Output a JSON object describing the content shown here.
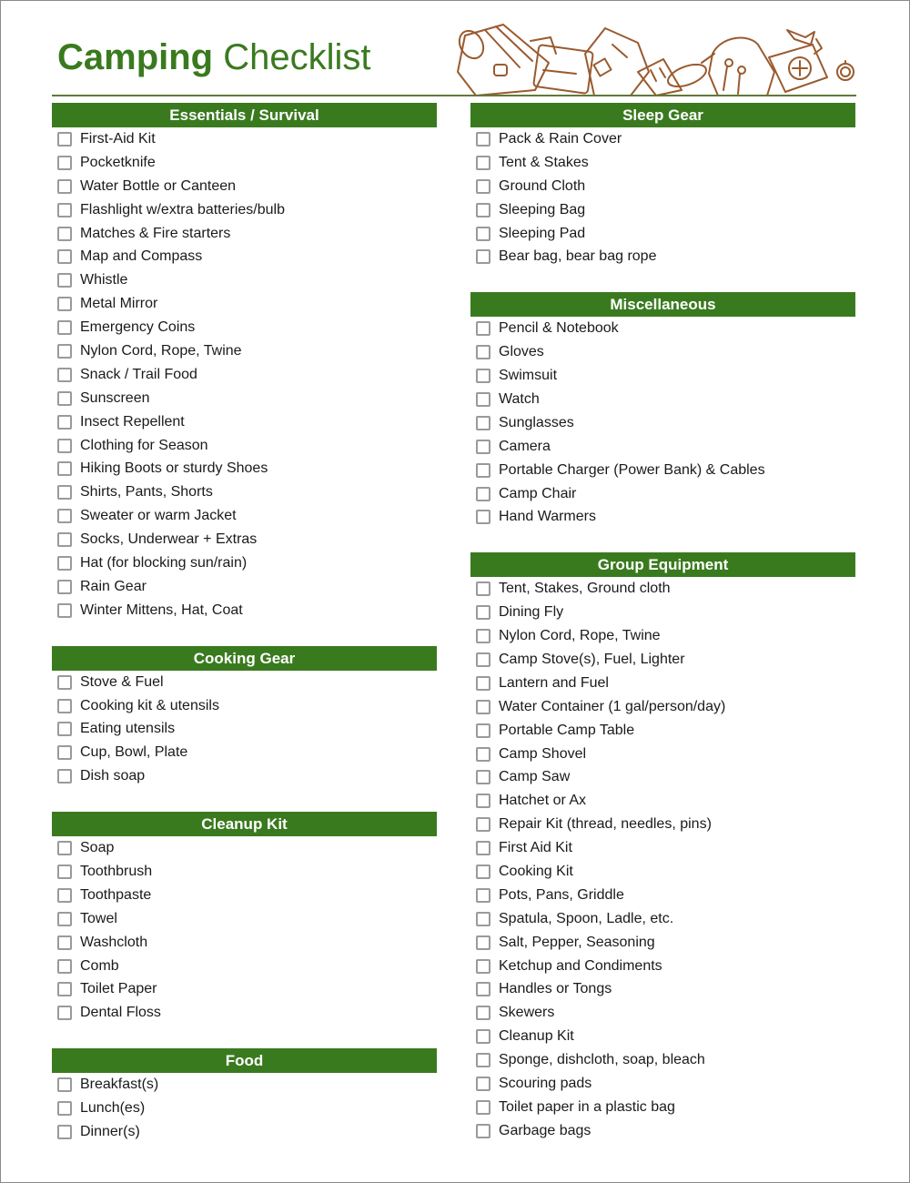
{
  "title": {
    "bold": "Camping",
    "regular": "Checklist"
  },
  "colors": {
    "accent": "#3a7a1f",
    "illustration": "#9a5a2e",
    "checkbox_border": "#9a9a9a"
  },
  "illustration": {
    "icons": [
      "sleeping-bag-icon",
      "suitcase-icon",
      "map-icon",
      "sunscreen-icon",
      "fish-icon",
      "backpack-icon",
      "first-aid-kit-icon",
      "pocketknife-icon",
      "compass-icon"
    ]
  },
  "left_column": [
    {
      "header": "Essentials / Survival",
      "items": [
        "First-Aid Kit",
        "Pocketknife",
        "Water Bottle or Canteen",
        "Flashlight w/extra batteries/bulb",
        "Matches & Fire starters",
        "Map and Compass",
        "Whistle",
        "Metal Mirror",
        "Emergency Coins",
        "Nylon Cord, Rope, Twine",
        "Snack / Trail Food",
        "Sunscreen",
        "Insect Repellent",
        "Clothing for Season",
        "Hiking Boots or sturdy Shoes",
        "Shirts, Pants, Shorts",
        "Sweater or warm Jacket",
        "Socks, Underwear + Extras",
        "Hat (for blocking sun/rain)",
        "Rain Gear",
        "Winter Mittens, Hat, Coat"
      ]
    },
    {
      "header": "Cooking Gear",
      "items": [
        "Stove & Fuel",
        "Cooking kit & utensils",
        "Eating utensils",
        "Cup, Bowl, Plate",
        "Dish soap"
      ]
    },
    {
      "header": "Cleanup Kit",
      "items": [
        "Soap",
        "Toothbrush",
        "Toothpaste",
        "Towel",
        "Washcloth",
        "Comb",
        "Toilet Paper",
        "Dental Floss"
      ]
    },
    {
      "header": "Food",
      "items": [
        "Breakfast(s)",
        "Lunch(es)",
        "Dinner(s)"
      ]
    }
  ],
  "right_column": [
    {
      "header": "Sleep Gear",
      "items": [
        "Pack & Rain Cover",
        "Tent & Stakes",
        "Ground Cloth",
        "Sleeping Bag",
        "Sleeping Pad",
        "Bear bag, bear bag rope"
      ]
    },
    {
      "header": "Miscellaneous",
      "items": [
        "Pencil & Notebook",
        "Gloves",
        "Swimsuit",
        "Watch",
        "Sunglasses",
        "Camera",
        "Portable Charger (Power Bank) & Cables",
        "Camp Chair",
        "Hand Warmers"
      ]
    },
    {
      "header": "Group Equipment",
      "items": [
        "Tent, Stakes, Ground cloth",
        "Dining Fly",
        "Nylon Cord, Rope, Twine",
        "Camp Stove(s), Fuel, Lighter",
        "Lantern and Fuel",
        "Water Container (1 gal/person/day)",
        "Portable Camp Table",
        "Camp Shovel",
        "Camp Saw",
        "Hatchet or Ax",
        "Repair Kit (thread, needles, pins)",
        "First Aid Kit",
        "Cooking Kit",
        "Pots, Pans, Griddle",
        "Spatula, Spoon, Ladle, etc.",
        "Salt, Pepper, Seasoning",
        "Ketchup and Condiments",
        "Handles or Tongs",
        "Skewers",
        "Cleanup Kit",
        "Sponge, dishcloth, soap, bleach",
        "Scouring pads",
        "Toilet paper in a plastic bag",
        "Garbage bags"
      ]
    }
  ]
}
